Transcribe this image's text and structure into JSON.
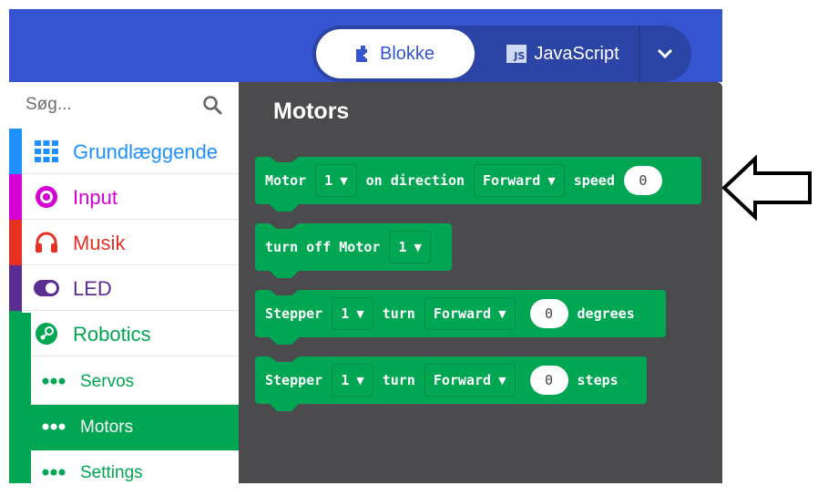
{
  "header": {
    "blocks_label": "Blokke",
    "javascript_label": "JavaScript",
    "js_icon_text": "JS",
    "accent_color": "#3454d1"
  },
  "sidebar": {
    "search_placeholder": "Søg...",
    "categories": [
      {
        "label": "Grundlæggende",
        "color": "#1e90ff",
        "icon": "grid-icon"
      },
      {
        "label": "Input",
        "color": "#d400d4",
        "icon": "target-icon"
      },
      {
        "label": "Musik",
        "color": "#e63022",
        "icon": "headphones-icon"
      },
      {
        "label": "LED",
        "color": "#5c2d91",
        "icon": "toggle-icon"
      },
      {
        "label": "Robotics",
        "color": "#00a651",
        "icon": "steam-icon"
      }
    ],
    "subcategories": [
      {
        "label": "Servos"
      },
      {
        "label": "Motors",
        "selected": true
      },
      {
        "label": "Settings"
      }
    ]
  },
  "flyout": {
    "title": "Motors",
    "blocks": [
      {
        "b0": "Motor",
        "d0": "1",
        "b1": "on direction",
        "d1": "Forward",
        "b2": "speed",
        "n0": "0"
      },
      {
        "b0": "turn off Motor",
        "d0": "1"
      },
      {
        "b0": "Stepper",
        "d0": "1",
        "b1": "turn",
        "d1": "Forward",
        "n0": "0",
        "b2": "degrees"
      },
      {
        "b0": "Stepper",
        "d0": "1",
        "b1": "turn",
        "d1": "Forward",
        "n0": "0",
        "b2": "steps"
      }
    ],
    "block_color": "#00a651",
    "background_color": "#4b4a4c"
  }
}
